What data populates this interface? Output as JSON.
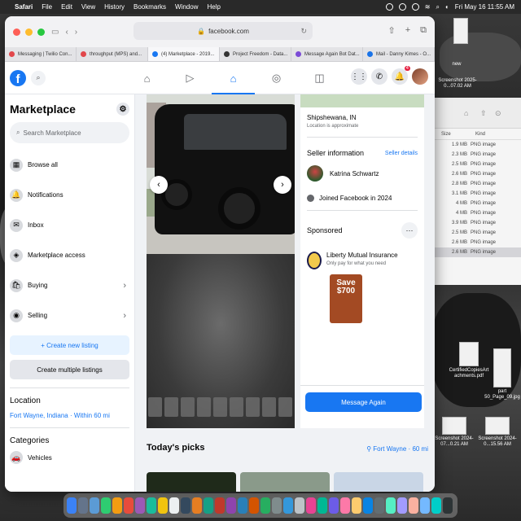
{
  "menubar": {
    "app": "Safari",
    "items": [
      "File",
      "Edit",
      "View",
      "History",
      "Bookmarks",
      "Window",
      "Help"
    ],
    "datetime": "Fri May 16  11:55 AM"
  },
  "finder": {
    "headers": [
      "Size",
      "Kind"
    ],
    "rows": [
      {
        "size": "1.9 MB",
        "kind": "PNG image"
      },
      {
        "size": "2.3 MB",
        "kind": "PNG image"
      },
      {
        "size": "2.5 MB",
        "kind": "PNG image"
      },
      {
        "size": "2.6 MB",
        "kind": "PNG image"
      },
      {
        "size": "2.8 MB",
        "kind": "PNG image"
      },
      {
        "size": "3.1 MB",
        "kind": "PNG image"
      },
      {
        "size": "4 MB",
        "kind": "PNG image"
      },
      {
        "size": "4 MB",
        "kind": "PNG image"
      },
      {
        "size": "3.9 MB",
        "kind": "PNG image"
      },
      {
        "size": "2.5 MB",
        "kind": "PNG image"
      },
      {
        "size": "2.6 MB",
        "kind": "PNG image"
      },
      {
        "size": "2.6 MB",
        "kind": "PNG image"
      }
    ]
  },
  "desktop_icons": [
    {
      "label": "new"
    },
    {
      "label": "Screenshot 2025-0...07.02 AM"
    },
    {
      "label": "CertifiedCopiesArt achments.pdf"
    },
    {
      "label": "part 50_Page_09.jpg"
    },
    {
      "label": "Screenshot 2024-07...0.21 AM"
    },
    {
      "label": "Screenshot 2024-0...15.56 AM"
    }
  ],
  "browser": {
    "url": "facebook.com",
    "tabs": [
      {
        "title": "Messaging | Twilio Con...",
        "color": "#e2474b"
      },
      {
        "title": "throughput (MPS) and...",
        "color": "#e2474b"
      },
      {
        "title": "(4) Marketplace - 2019...",
        "color": "#1877f2"
      },
      {
        "title": "Project Freedom - Data...",
        "color": "#333333"
      },
      {
        "title": "Message Again Bot Dat...",
        "color": "#7b4bd6"
      },
      {
        "title": "Mail - Danny Kimes - O...",
        "color": "#1a73e8"
      }
    ],
    "active_tab": 2
  },
  "fbnav": {
    "logo": "f",
    "notification_count": "4",
    "icons": [
      "home-icon",
      "video-icon",
      "marketplace-icon",
      "groups-icon",
      "gaming-icon"
    ]
  },
  "sidebar": {
    "title": "Marketplace",
    "search_placeholder": "Search Marketplace",
    "items": [
      {
        "label": "Browse all",
        "icon": "▦"
      },
      {
        "label": "Notifications",
        "icon": "🔔"
      },
      {
        "label": "Inbox",
        "icon": "✉"
      },
      {
        "label": "Marketplace access",
        "icon": "◈"
      },
      {
        "label": "Buying",
        "icon": "🛍",
        "chevron": "›"
      },
      {
        "label": "Selling",
        "icon": "◉",
        "chevron": "›"
      }
    ],
    "create_listing": "+  Create new listing",
    "create_multiple": "Create multiple listings",
    "location_heading": "Location",
    "location_value": "Fort Wayne, Indiana · Within 60 mi",
    "categories_heading": "Categories",
    "categories": [
      {
        "label": "Vehicles"
      }
    ]
  },
  "listing": {
    "city": "Shipshewana, IN",
    "approx": "Location is approximate",
    "seller_info_heading": "Seller information",
    "seller_details_link": "Seller details",
    "seller_name": "Katrina Schwartz",
    "joined": "Joined Facebook in 2024",
    "sponsored_heading": "Sponsored",
    "more": "···",
    "ad_title": "Liberty Mutual Insurance",
    "ad_subtitle": "Only pay for what you need",
    "ad_image_text": "Save $700",
    "message_button": "Message Again"
  },
  "todays_picks": {
    "heading": "Today's picks",
    "location": "Fort Wayne · 60 mi"
  },
  "colors": {
    "facebook_blue": "#1877f2",
    "background": "#f0f2f5"
  }
}
